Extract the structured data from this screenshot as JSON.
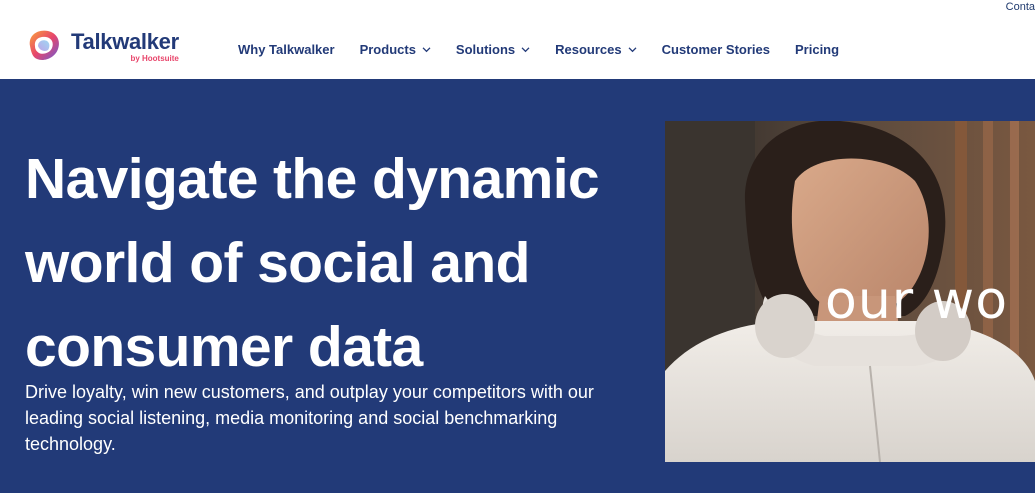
{
  "header": {
    "contact_label": "Conta",
    "logo": {
      "wordmark": "Talkwalker",
      "sub": "by Hootsuite",
      "icon": "talkwalker-logo-icon"
    },
    "nav": [
      {
        "label": "Why Talkwalker",
        "dropdown": false
      },
      {
        "label": "Products",
        "dropdown": true
      },
      {
        "label": "Solutions",
        "dropdown": true
      },
      {
        "label": "Resources",
        "dropdown": true
      },
      {
        "label": "Customer Stories",
        "dropdown": false
      },
      {
        "label": "Pricing",
        "dropdown": false
      }
    ]
  },
  "hero": {
    "title": "Navigate the dynamic world of social and consumer data",
    "subtitle": "Drive loyalty, win new customers, and outplay your competitors with our leading social listening, media monitoring and social benchmarking technology.",
    "image_overlay_text": "our wo"
  },
  "colors": {
    "brand_navy": "#223a78",
    "brand_pink": "#e8456b",
    "text_white": "#ffffff"
  }
}
